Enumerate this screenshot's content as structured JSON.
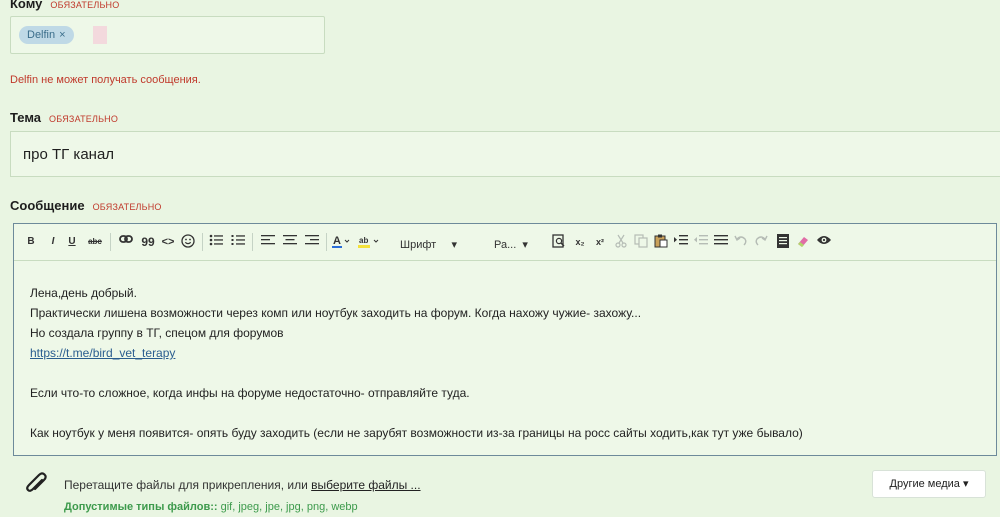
{
  "to": {
    "label": "Кому",
    "required": "ОБЯЗАТЕЛЬНО",
    "recipient": "Delfin",
    "remove": "×",
    "error": "Delfin не может получать сообщения."
  },
  "subject": {
    "label": "Тема",
    "required": "ОБЯЗАТЕЛЬНО",
    "value": "про ТГ канал"
  },
  "message": {
    "label": "Сообщение",
    "required": "ОБЯЗАТЕЛЬНО",
    "toolbar": {
      "font": "Шрифт",
      "size": "Ра...",
      "bold": "B",
      "italic": "I",
      "underline": "U",
      "strike": "abc",
      "quote": "99",
      "code": "<>",
      "sub": "x₂",
      "sup": "x²"
    },
    "lines": [
      "Лена,день добрый.",
      "Практически лишена возможности через комп или ноутбук заходить на форум. Когда нахожу чужие- захожу...",
      "Но создала группу в ТГ, спецом для форумов",
      "https://t.me/bird_vet_terapy",
      "",
      "Если что-то сложное, когда инфы на форуме недостаточно- отправляйте туда.",
      "",
      "Как ноутбук у меня появится- опять буду заходить (если не зарубят возможности из-за границы на росс сайты ходить,как тут уже бывало)"
    ]
  },
  "attachments": {
    "text": "Перетащите файлы для прикрепления, или",
    "link": "выберите файлы ...",
    "types_label": "Допустимые типы файлов::",
    "types": "gif, jpeg, jpe, jpg, png, webp",
    "media_button": "Другие медиа ▾"
  },
  "colors": {
    "background": "#e9f5e2",
    "required": "#c0392b",
    "chip": "#bfd9e6",
    "types": "#3d9a4c"
  }
}
